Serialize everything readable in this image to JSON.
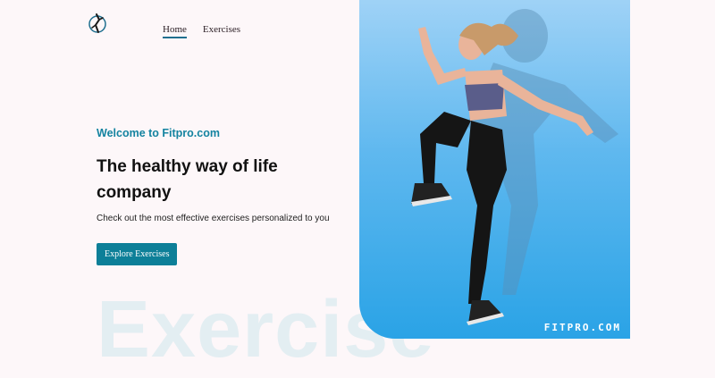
{
  "header": {
    "logo_icon": "runner-logo-icon",
    "nav": [
      {
        "label": "Home",
        "active": true
      },
      {
        "label": "Exercises",
        "active": false
      }
    ]
  },
  "hero": {
    "welcome": "Welcome to Fitpro.com",
    "headline": "The healthy way of life company",
    "subtext": "Check out the most effective exercises personalized to you",
    "cta_label": "Explore Exercises",
    "background_word": "Exercise",
    "brand_watermark": "FITPRO.COM",
    "image": "woman-jumping-exercise-photo"
  },
  "colors": {
    "accent": "#1483a0",
    "button": "#0d7f98",
    "page_bg": "#fdf7f9",
    "hero_bg": "#2aa3e6"
  }
}
